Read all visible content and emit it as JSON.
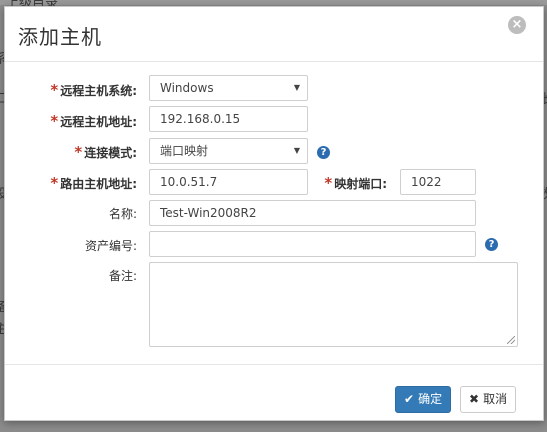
{
  "background": {
    "top_text": "上级目录",
    "left_chars": [
      "系",
      "口",
      "设",
      "备",
      "主"
    ],
    "right_chars": [
      "张",
      "数"
    ]
  },
  "modal": {
    "title": "添加主机",
    "close_icon": "close-icon"
  },
  "form": {
    "required_mark": "*",
    "remote_os": {
      "label": "远程主机系统:",
      "value": "Windows"
    },
    "remote_addr": {
      "label": "远程主机地址:",
      "value": "192.168.0.15"
    },
    "connect_mode": {
      "label": "连接模式:",
      "value": "端口映射"
    },
    "router_addr": {
      "label": "路由主机地址:",
      "value": "10.0.51.7"
    },
    "mapped_port": {
      "label": "映射端口:",
      "value": "1022"
    },
    "name": {
      "label": "名称:",
      "value": "Test-Win2008R2"
    },
    "asset_no": {
      "label": "资产编号:",
      "value": ""
    },
    "note": {
      "label": "备注:",
      "value": ""
    },
    "help_icon_text": "?"
  },
  "footer": {
    "confirm_label": "确定",
    "cancel_label": "取消",
    "confirm_icon": "✔",
    "cancel_icon": "✖"
  },
  "colors": {
    "primary": "#337ab7",
    "required": "#c0392b",
    "help": "#2b6cb0"
  }
}
